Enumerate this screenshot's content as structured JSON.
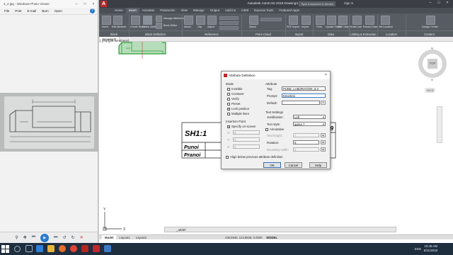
{
  "photo_viewer": {
    "title": "4_2.jpg - Windows Photo Viewer",
    "menu": [
      "File",
      "Print",
      "E-mail",
      "Burn",
      "Open"
    ],
    "help": "?"
  },
  "acad": {
    "logo": "A",
    "title": "Autodesk AutoCAD 2018    Drawing3.dwg",
    "search_placeholder": "Type a keyword or phrase",
    "signin": "Sign In",
    "ribbon_tabs": [
      "Home",
      "Insert",
      "Annotate",
      "Parametric",
      "View",
      "Manage",
      "Output",
      "Add-ins",
      "A360",
      "Express Tools",
      "Featured Apps"
    ],
    "active_tab": "Insert",
    "panels": [
      "Block",
      "Block Definition",
      "Reference",
      "Point Cloud",
      "Import",
      "Data",
      "Linking & Extraction",
      "Location",
      "Content"
    ],
    "ribbon_labels": [
      "Insert",
      "Edit Attribute",
      "Create Block",
      "Define Attributes",
      "Manage Attributes",
      "Block Editor",
      "Attach",
      "Clip",
      "Adjust",
      "Attach",
      "PDF Import",
      "Import",
      "Field",
      "Update Fields",
      "OLE Object",
      "Data Link",
      "Extract Data",
      "Set Location",
      "Design Center"
    ],
    "file_tab": "Drawing3*",
    "viewport_label": "[-][Top][2D Wireframe]",
    "viewcube": {
      "top": "TOP",
      "n": "N",
      "s": "S"
    },
    "wcs": "WCS",
    "command_line": "_attdef",
    "layout_tabs": [
      "Model",
      "Layout1",
      "Layout2"
    ],
    "coords": "238.5940, 123.8526, 0.0000",
    "model_label": "MODEL",
    "title_block": {
      "sheet": "SH1:1",
      "row1": "Punoi",
      "row2": "Pranoi",
      "cut_number": "19"
    },
    "ucs": {
      "x": "X",
      "y": "Y"
    }
  },
  "dialog": {
    "title": "Attribute Definition",
    "mode": {
      "label": "Mode",
      "options": [
        {
          "label": "Invisible",
          "checked": false
        },
        {
          "label": "Constant",
          "checked": false
        },
        {
          "label": "Verify",
          "checked": false
        },
        {
          "label": "Preset",
          "checked": false
        },
        {
          "label": "Lock position",
          "checked": true
        },
        {
          "label": "Multiple lines",
          "checked": false
        }
      ]
    },
    "attribute": {
      "label": "Attribute",
      "tag_label": "Tag:",
      "tag_value": "PUNE_LABORATORI_8.3",
      "prompt_label": "Prompt:",
      "prompt_value": "Emertimi",
      "default_label": "Default:",
      "default_value": ""
    },
    "insertion_point": {
      "label": "Insertion Point",
      "specify_label": "Specify on-screen",
      "specify_checked": true,
      "x_label": "X:",
      "x_value": "0",
      "y_label": "Y:",
      "y_value": "0",
      "z_label": "Z:",
      "z_value": "0"
    },
    "text_settings": {
      "label": "Text Settings",
      "justification_label": "Justification:",
      "justification_value": "Left",
      "text_style_label": "Text style:",
      "text_style_value": "gama 7",
      "annotative_label": "Annotative",
      "annotative_checked": false,
      "text_height_label": "Text height:",
      "text_height_value": "7",
      "rotation_label": "Rotation:",
      "rotation_value": "0",
      "boundary_width_label": "Boundary width:",
      "boundary_width_value": "0"
    },
    "align_label": "Align below previous attribute definition",
    "align_checked": false,
    "buttons": {
      "ok": "OK",
      "cancel": "Cancel",
      "help": "Help"
    }
  },
  "taskbar": {
    "language": "ENG",
    "time": "10:46 AM",
    "date": "5/11/2018"
  },
  "colors": {
    "acad_dark": "#3b3f45",
    "ribbon": "#575c63",
    "taskbar": "#1f2e3f",
    "acad_red": "#c0282d",
    "block_green": "#2e9e3a"
  }
}
